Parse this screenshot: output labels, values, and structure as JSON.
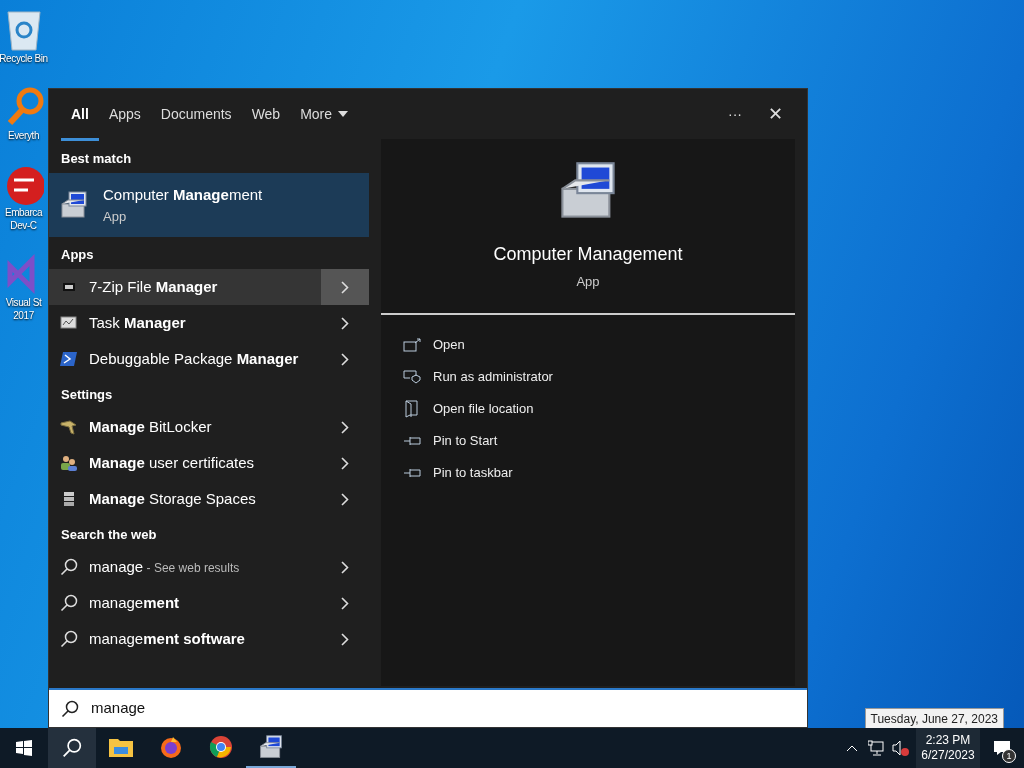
{
  "desktop_icons": [
    {
      "lines": [
        "Recycle Bin"
      ]
    },
    {
      "lines": [
        "Everyth"
      ]
    },
    {
      "lines": [
        "Embarca",
        "Dev-C"
      ]
    },
    {
      "lines": [
        "Visual St",
        "2017"
      ]
    }
  ],
  "search_panel": {
    "tabs": [
      {
        "label": "All",
        "selected": true
      },
      {
        "label": "Apps",
        "selected": false
      },
      {
        "label": "Documents",
        "selected": false
      },
      {
        "label": "Web",
        "selected": false
      }
    ],
    "more_label": "More",
    "options_label": "···",
    "close_label": "✕",
    "best_match": {
      "heading": "Best match",
      "title": "Computer **Manage**ment",
      "subtitle": "App",
      "selected": true
    },
    "groups": [
      {
        "heading": "Apps",
        "items": [
          {
            "kind": "app",
            "label": "7-Zip File **Manager**",
            "hovered": true
          },
          {
            "kind": "app",
            "label": "Task **Manager**",
            "hovered": false
          },
          {
            "kind": "app",
            "label": "Debuggable Package **Manager**",
            "hovered": false
          }
        ]
      },
      {
        "heading": "Settings",
        "items": [
          {
            "kind": "setting",
            "label": "**Manage** BitLocker",
            "hovered": false
          },
          {
            "kind": "setting",
            "label": "**Manage** user certificates",
            "hovered": false
          },
          {
            "kind": "setting",
            "label": "**Manage** Storage Spaces",
            "hovered": false
          }
        ]
      },
      {
        "heading": "Search the web",
        "items": [
          {
            "kind": "web",
            "label": "manage",
            "suffix": "- See web results",
            "hovered": false
          },
          {
            "kind": "web",
            "label": "manage**ment**",
            "hovered": false
          },
          {
            "kind": "web",
            "label": "manage**ment software**",
            "hovered": false
          }
        ]
      }
    ],
    "preview": {
      "title": "Computer Management",
      "subtitle": "App",
      "actions": [
        "Open",
        "Run as administrator",
        "Open file location",
        "Pin to Start",
        "Pin to taskbar"
      ]
    },
    "search_box": {
      "value": "manage"
    }
  },
  "taskbar": {
    "search_active": true,
    "apps": [
      {
        "running": false
      },
      {
        "running": false
      },
      {
        "running": false
      },
      {
        "running": true
      }
    ],
    "time": "2:23 PM",
    "date": "6/27/2023",
    "notifications": "1",
    "date_tooltip": "Tuesday, June 27, 2023"
  }
}
